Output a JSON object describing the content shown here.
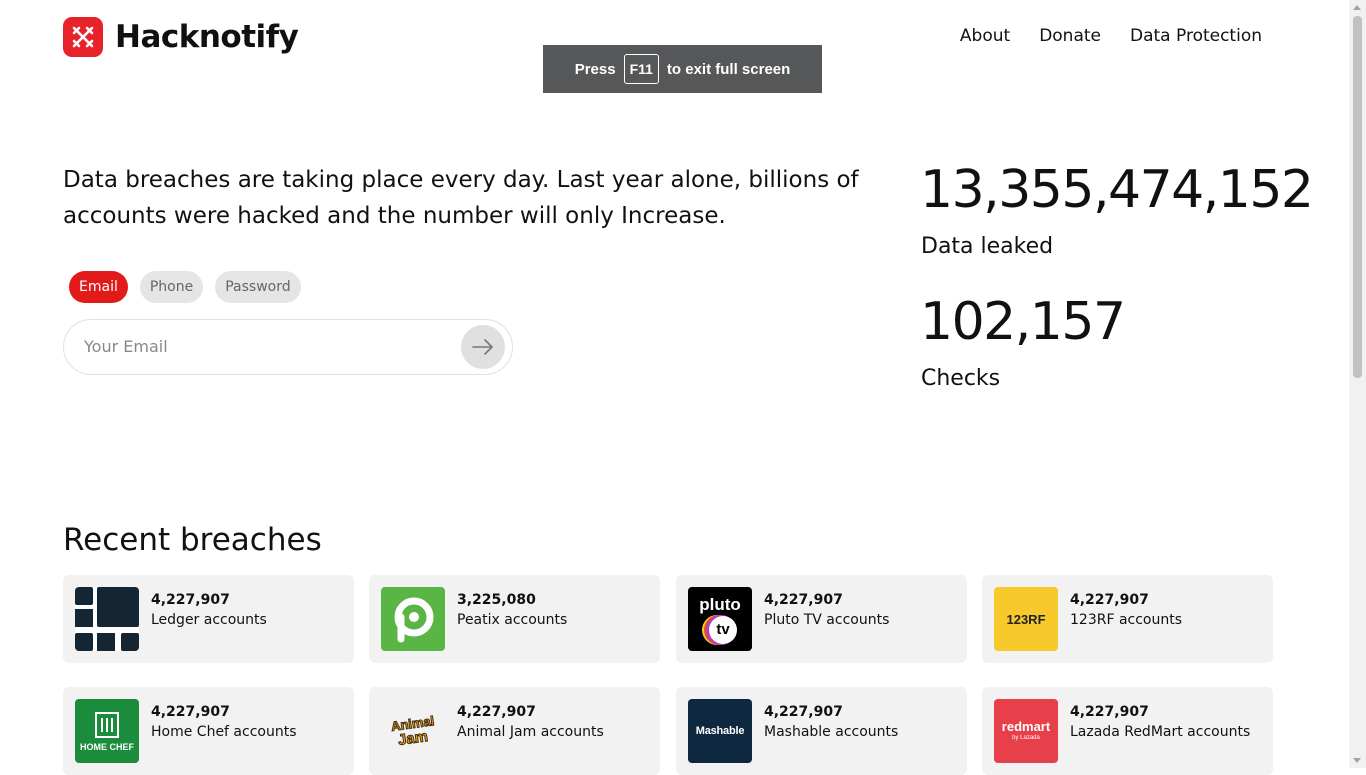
{
  "header": {
    "brand": "Hacknotify",
    "nav": [
      "About",
      "Donate",
      "Data Protection"
    ]
  },
  "fullscreen_notice": {
    "before": "Press",
    "key": "F11",
    "after": "to exit full screen"
  },
  "hero": {
    "text": "Data breaches are taking place every day. Last year alone, billions of accounts were hacked and the number will only Increase."
  },
  "search": {
    "tabs": [
      "Email",
      "Phone",
      "Password"
    ],
    "active_tab": "Email",
    "placeholder": "Your Email"
  },
  "stats": [
    {
      "value": "13,355,474,152",
      "label": "Data leaked"
    },
    {
      "value": "102,157",
      "label": "Checks"
    }
  ],
  "breaches": {
    "title": "Recent breaches",
    "items": [
      {
        "count": "4,227,907",
        "name": "Ledger accounts",
        "logo": "ledger-logo"
      },
      {
        "count": "3,225,080",
        "name": "Peatix accounts",
        "logo": "peatix-logo"
      },
      {
        "count": "4,227,907",
        "name": "Pluto TV accounts",
        "logo": "pluto-tv-logo",
        "logo_text": [
          "pluto",
          "tv"
        ]
      },
      {
        "count": "4,227,907",
        "name": "123RF accounts",
        "logo": "123rf-logo",
        "logo_text": "123RF"
      },
      {
        "count": "4,227,907",
        "name": "Home Chef accounts",
        "logo": "home-chef-logo",
        "logo_text": "HOME CHEF"
      },
      {
        "count": "4,227,907",
        "name": "Animal Jam accounts",
        "logo": "animal-jam-logo",
        "logo_text": [
          "Animal",
          "Jam"
        ]
      },
      {
        "count": "4,227,907",
        "name": "Mashable accounts",
        "logo": "mashable-logo",
        "logo_text": "Mashable"
      },
      {
        "count": "4,227,907",
        "name": "Lazada RedMart accounts",
        "logo": "redmart-logo",
        "logo_text": [
          "redmart",
          "by Lazada"
        ]
      }
    ]
  },
  "colors": {
    "brand_red": "#e8222b",
    "active_tab": "#e31a1a",
    "card_bg": "#f2f2f2"
  }
}
